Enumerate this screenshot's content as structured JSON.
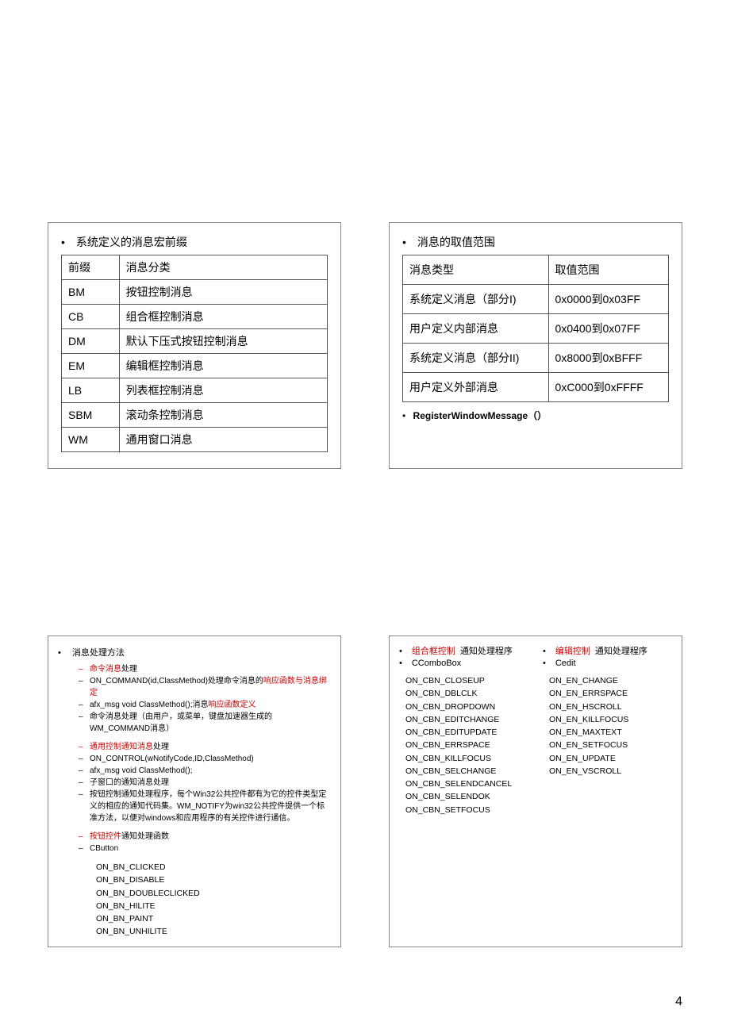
{
  "pageNumber": "4",
  "card1": {
    "title": "系统定义的消息宏前缀",
    "headers": [
      "前缀",
      "消息分类"
    ],
    "rows": [
      [
        "BM",
        "按钮控制消息"
      ],
      [
        "CB",
        "组合框控制消息"
      ],
      [
        "DM",
        "默认下压式按钮控制消息"
      ],
      [
        "EM",
        "编辑框控制消息"
      ],
      [
        "LB",
        "列表框控制消息"
      ],
      [
        "SBM",
        "滚动条控制消息"
      ],
      [
        "WM",
        "通用窗口消息"
      ]
    ]
  },
  "card2": {
    "title": "消息的取值范围",
    "headers": [
      "消息类型",
      "取值范围"
    ],
    "rows": [
      [
        "系统定义消息（部分I)",
        "0x0000到0x03FF"
      ],
      [
        "用户定义内部消息",
        "0x0400到0x07FF"
      ],
      [
        "系统定义消息（部分II)",
        "0x8000到0xBFFF"
      ],
      [
        "用户定义外部消息",
        "0xC000到0xFFFF"
      ]
    ],
    "footnote": "RegisterWindowMessage（）"
  },
  "card3": {
    "title": "消息处理方法",
    "groups": [
      {
        "head_red": "命令消息",
        "head_black": "处理",
        "items": [
          {
            "pre": "ON_COMMAND(id,ClassMethod)处理命令消息的",
            "red": "响应函数与消息绑定",
            "post": ""
          },
          {
            "pre": "afx_msg void ClassMethod();消息",
            "red": "响应函数定义",
            "post": ""
          },
          {
            "pre": "命令消息处理（由用户，或菜单，键盘加速器生成的WM_COMMAND消息）",
            "red": "",
            "post": ""
          }
        ]
      },
      {
        "head_red": "通用控制通知消息",
        "head_black": "处理",
        "items": [
          {
            "pre": "ON_CONTROL(wNotifyCode,ID,ClassMethod)",
            "red": "",
            "post": ""
          },
          {
            "pre": "afx_msg void ClassMethod();",
            "red": "",
            "post": ""
          },
          {
            "pre": "子窗口的通知消息处理",
            "red": "",
            "post": ""
          },
          {
            "pre": "按钮控制通知处理程序，每个Win32公共控件都有为它的控件类型定义的相应的通知代码集。WM_NOTIFY为win32公共控件提供一个标准方法，以便对windows和应用程序的有关控件进行通信。",
            "red": "",
            "post": ""
          }
        ]
      },
      {
        "head_red": "按钮控件",
        "head_black": "通知处理函数",
        "items": [
          {
            "pre": "CButton",
            "red": "",
            "post": ""
          }
        ]
      }
    ],
    "constants": [
      "ON_BN_CLICKED",
      "ON_BN_DISABLE",
      "ON_BN_DOUBLECLICKED",
      "ON_BN_HILITE",
      "ON_BN_PAINT",
      "ON_BN_UNHILITE"
    ]
  },
  "card4": {
    "colA": {
      "head_red": "组合框控制",
      "head_black": "通知处理程序",
      "sub": "CComboBox",
      "constants": [
        "ON_CBN_CLOSEUP",
        "ON_CBN_DBLCLK",
        "ON_CBN_DROPDOWN",
        "ON_CBN_EDITCHANGE",
        "ON_CBN_EDITUPDATE",
        "ON_CBN_ERRSPACE",
        "ON_CBN_KILLFOCUS",
        "ON_CBN_SELCHANGE",
        "ON_CBN_SELENDCANCEL",
        "ON_CBN_SELENDOK",
        "ON_CBN_SETFOCUS"
      ]
    },
    "colB": {
      "head_red": "编辑控制",
      "head_black": "通知处理程序",
      "sub": "Cedit",
      "constants": [
        "ON_EN_CHANGE",
        "ON_EN_ERRSPACE",
        "ON_EN_HSCROLL",
        "ON_EN_KILLFOCUS",
        "ON_EN_MAXTEXT",
        "ON_EN_SETFOCUS",
        "ON_EN_UPDATE",
        "ON_EN_VSCROLL"
      ]
    }
  }
}
